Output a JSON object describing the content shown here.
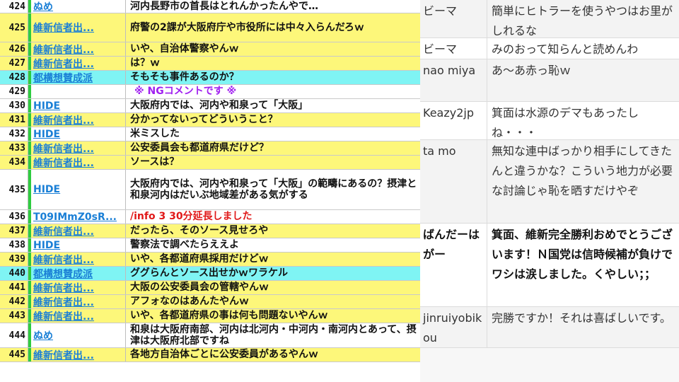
{
  "left_rows": [
    {
      "num": "424",
      "name": "ぬめ",
      "comment": "河内長野市の首長はとれんかったんやで…",
      "bg": "white",
      "style": ""
    },
    {
      "num": "425",
      "name": "維新信者出...",
      "comment": "府警の2課が大阪府庁や市役所には中々入らんだろｗ",
      "bg": "yellow",
      "style": ""
    },
    {
      "num": "426",
      "name": "維新信者出...",
      "comment": "いや、自治体警察やんｗ",
      "bg": "yellow",
      "style": ""
    },
    {
      "num": "427",
      "name": "維新信者出...",
      "comment": "は？ｗ",
      "bg": "yellow",
      "style": ""
    },
    {
      "num": "428",
      "name": "都構想賛成派",
      "comment": "そもそも事件あるのか？",
      "bg": "cyan",
      "style": ""
    },
    {
      "num": "429",
      "name": "",
      "comment": "※ NGコメントです ※",
      "bg": "white",
      "style": "ng"
    },
    {
      "num": "430",
      "name": "HIDE",
      "comment": "大阪府内では、河内や和泉って「大阪」",
      "bg": "white",
      "style": ""
    },
    {
      "num": "431",
      "name": "維新信者出...",
      "comment": "分かってないってどういうこと？",
      "bg": "yellow",
      "style": ""
    },
    {
      "num": "432",
      "name": "HIDE",
      "comment": "米ミスした",
      "bg": "white",
      "style": ""
    },
    {
      "num": "433",
      "name": "維新信者出...",
      "comment": "公安委員会も都道府県だけど？",
      "bg": "yellow",
      "style": ""
    },
    {
      "num": "434",
      "name": "維新信者出...",
      "comment": "ソースは？",
      "bg": "yellow",
      "style": ""
    },
    {
      "num": "435",
      "name": "HIDE",
      "comment": "大阪府内では、河内や和泉って「大阪」の範疇にあるの？摂津と和泉河内はだいぶ地域差がある気がする",
      "bg": "white",
      "style": ""
    },
    {
      "num": "436",
      "name": "T09IMmZ0sR...",
      "comment": "/info 3 30分延長しました",
      "bg": "white",
      "style": "red"
    },
    {
      "num": "437",
      "name": "維新信者出...",
      "comment": "だったら、そのソース見せろや",
      "bg": "yellow",
      "style": ""
    },
    {
      "num": "438",
      "name": "HIDE",
      "comment": "警察法で調べたらええよ",
      "bg": "white",
      "style": ""
    },
    {
      "num": "439",
      "name": "維新信者出...",
      "comment": "いや、各都道府県採用だけどｗ",
      "bg": "yellow",
      "style": ""
    },
    {
      "num": "440",
      "name": "都構想賛成派",
      "comment": "ググらんとソース出せかｗワラケル",
      "bg": "cyan",
      "style": ""
    },
    {
      "num": "441",
      "name": "維新信者出...",
      "comment": "大阪の公安委員会の管轄やんｗ",
      "bg": "yellow",
      "style": ""
    },
    {
      "num": "442",
      "name": "維新信者出...",
      "comment": "アフォなのはあんたやんｗ",
      "bg": "yellow",
      "style": ""
    },
    {
      "num": "443",
      "name": "維新信者出...",
      "comment": "いや、各都道府県の事は何も問題ないやんｗ",
      "bg": "yellow",
      "style": ""
    },
    {
      "num": "444",
      "name": "ぬめ",
      "comment": "和泉は大阪府南部、河内は北河内・中河内・南河内とあって、摂津は大阪府北部ですね",
      "bg": "white",
      "style": ""
    },
    {
      "num": "445",
      "name": "維新信者出...",
      "comment": "各地方自治体ごとに公安委員があるやんｗ",
      "bg": "yellow",
      "style": ""
    }
  ],
  "right_rows": [
    {
      "name": "ビーマ",
      "msg": "簡単にヒトラーを使うやつはお里がしれるな",
      "bold": false
    },
    {
      "name": "ビーマ",
      "msg": "みのおって知らんと読めんわ",
      "bold": false
    },
    {
      "name": "nao miya",
      "msg": "あ～あ赤っ恥ｗ",
      "bold": false
    },
    {
      "name": "Keazy2jp",
      "msg": "箕面は水源のデマもあったしね・・・",
      "bold": false
    },
    {
      "name": "ta mo",
      "msg": "無知な連中ばっかり相手にしてきたんと違うかな？こういう地力が必要な討論じゃ恥を晒すだけやぞ",
      "bold": false
    },
    {
      "name": "ばんだーはがー",
      "msg": "箕面、維新完全勝利おめでとうございます！Ｎ国党は信時候補が負けでワシは涙しました。くやしい；；",
      "bold": true
    },
    {
      "name": "jinruiyobikou",
      "msg": "完勝ですか！それは喜ばしいです。",
      "bold": false
    }
  ],
  "colors": {
    "yellow": "#fdf77a",
    "cyan": "#7ff4f4",
    "link": "#1a7fd6",
    "ng": "#a020f0",
    "info": "#e01818",
    "bar": "#2ecc40"
  }
}
